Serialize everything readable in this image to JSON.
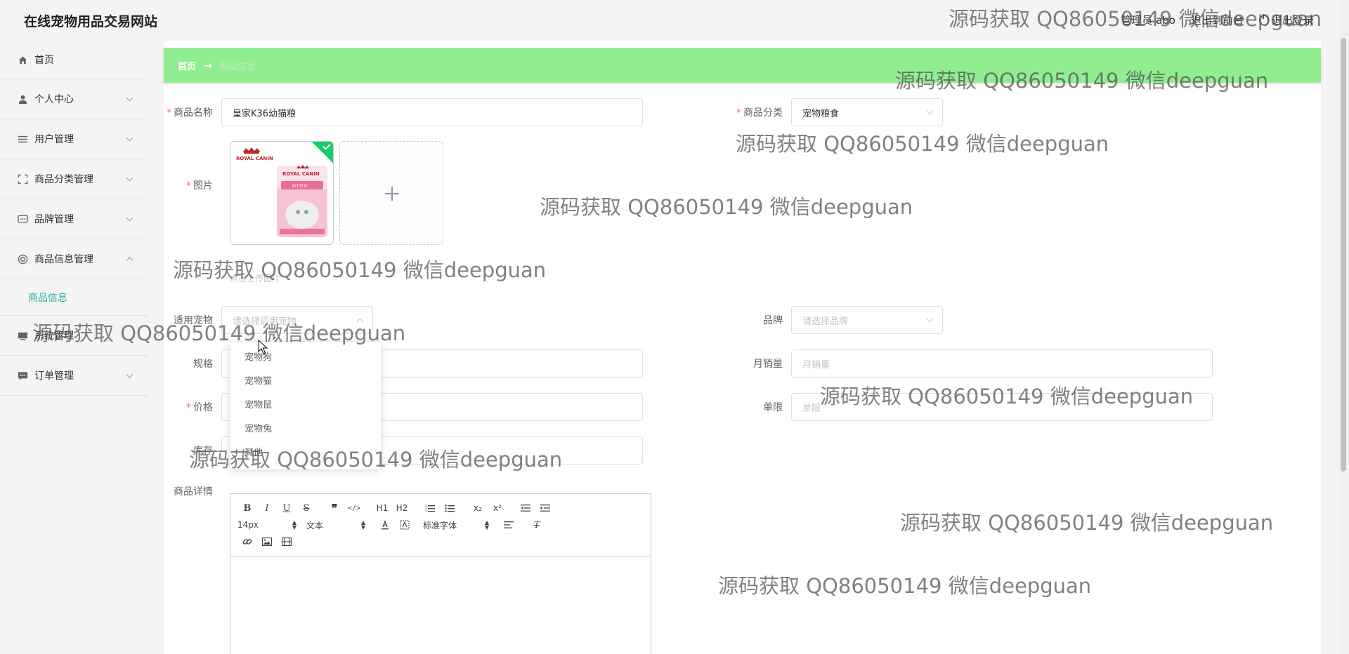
{
  "header": {
    "site_title": "在线宠物用品交易网站",
    "admin_text": "管理员 abo",
    "exit_to_frontend": "退出到前台",
    "logout": "退出登录"
  },
  "sidebar": {
    "items": [
      {
        "label": "首页",
        "icon": "home-icon"
      },
      {
        "label": "个人中心",
        "icon": "user-icon"
      },
      {
        "label": "用户管理",
        "icon": "list-icon"
      },
      {
        "label": "商品分类管理",
        "icon": "fullscreen-icon"
      },
      {
        "label": "品牌管理",
        "icon": "chat-icon"
      },
      {
        "label": "商品信息管理",
        "icon": "help-icon"
      },
      {
        "label": "系统管理",
        "icon": "monitor-icon"
      },
      {
        "label": "订单管理",
        "icon": "message-icon"
      }
    ],
    "subitem": "商品信息"
  },
  "breadcrumb": {
    "home": "首页",
    "separator": "→",
    "current": "商品信息"
  },
  "form": {
    "name_label": "商品名称",
    "name_value": "皇家K36幼猫粮",
    "category_label": "商品分类",
    "category_value": "宠物粮食",
    "image_label": "图片",
    "upload_tip": "点击上传图片",
    "pet_label": "适用宠物",
    "pet_placeholder": "请选择适用宠物",
    "brand_label": "品牌",
    "brand_placeholder": "请选择品牌",
    "spec_label": "规格",
    "monthly_sales_label": "月销量",
    "monthly_sales_placeholder": "月销量",
    "price_label": "价格",
    "limit_label": "单限",
    "limit_placeholder": "单限",
    "stock_label": "库存",
    "detail_label": "商品详情"
  },
  "pet_dropdown": [
    "宠物狗",
    "宠物猫",
    "宠物鼠",
    "宠物兔",
    "其他"
  ],
  "image": {
    "brand_text": "ROYAL CANIN",
    "bag_text": "KITTEN"
  },
  "editor": {
    "font_size": "14px",
    "text_style": "文本",
    "font_family": "标准字体",
    "buttons": [
      "B",
      "I",
      "U",
      "S",
      "❞",
      "</>",
      "H1",
      "H2",
      "ol",
      "ul",
      "x₂",
      "x²",
      "outdent",
      "indent"
    ]
  },
  "watermark": "源码获取 QQ86050149 微信deepguan"
}
